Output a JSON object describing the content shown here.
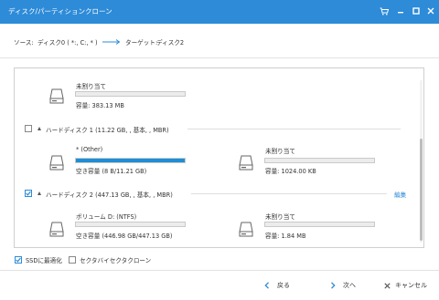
{
  "window": {
    "title": "ディスク/パーティションクローン"
  },
  "titlebar_icons": [
    "cart-icon",
    "minimize-icon",
    "maximize-icon",
    "close-icon"
  ],
  "route": {
    "source_label": "ソース:",
    "source_value": "ディスク0 ( *:, C:, * )",
    "target_label": "ターゲット:",
    "target_value": "ディスク2"
  },
  "disks": {
    "top_partition": {
      "name": "未割り当て",
      "capacity": "容量: 383.13 MB",
      "used_fraction": 0
    },
    "disk1": {
      "header": "ハードディスク 1 (11.22 GB, , 基本, , MBR)",
      "checked": false,
      "partitions": [
        {
          "name": "* (Other)",
          "capacity": "空き容量 (8 B/11.21 GB)",
          "used_fraction": 1.0
        },
        {
          "name": "未割り当て",
          "capacity": "容量: 1024.00 KB",
          "used_fraction": 0
        }
      ]
    },
    "disk2": {
      "header": "ハードディスク 2 (447.13 GB, , 基本, , MBR)",
      "checked": true,
      "edit_label": "編集",
      "partitions": [
        {
          "name": "ボリューム D: (NTFS)",
          "capacity": "空き容量 (446.98 GB/447.13 GB)",
          "used_fraction": 0.0
        },
        {
          "name": "未割り当て",
          "capacity": "容量: 1.84 MB",
          "used_fraction": 0
        }
      ]
    }
  },
  "options": {
    "ssd_label": "SSDに最適化",
    "ssd_checked": true,
    "sector_label": "セクタバイセクタクローン",
    "sector_checked": false
  },
  "footer": {
    "back_label": "戻る",
    "next_label": "次へ",
    "cancel_label": "キャンセル"
  },
  "colors": {
    "titlebar": "#2d8bd8",
    "bar_fill": "#1e8ed6",
    "accent": "#2d8bd8"
  }
}
